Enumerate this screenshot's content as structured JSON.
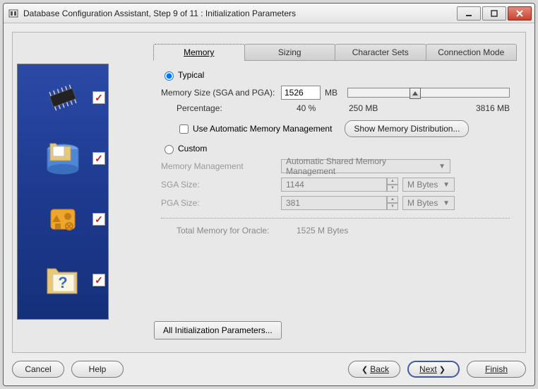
{
  "window": {
    "title": "Database Configuration Assistant, Step 9 of 11 : Initialization Parameters"
  },
  "tabs": {
    "memory": "Memory",
    "sizing": "Sizing",
    "charsets": "Character Sets",
    "connmode": "Connection Mode"
  },
  "typical": {
    "radio_label": "Typical",
    "mem_size_label": "Memory Size (SGA and PGA):",
    "mem_size_value": "1526",
    "mem_size_unit": "MB",
    "percentage_label": "Percentage:",
    "percentage_value": "40 %",
    "slider_min": "250 MB",
    "slider_max": "3816 MB",
    "auto_mem_label": "Use Automatic Memory Management",
    "show_btn": "Show Memory Distribution..."
  },
  "custom": {
    "radio_label": "Custom",
    "mem_mgmt_label": "Memory Management",
    "mem_mgmt_value": "Automatic Shared Memory Management",
    "sga_label": "SGA Size:",
    "sga_value": "1144",
    "sga_unit": "M Bytes",
    "pga_label": "PGA Size:",
    "pga_value": "381",
    "pga_unit": "M Bytes",
    "total_label": "Total Memory for Oracle:",
    "total_value": "1525 M Bytes"
  },
  "buttons": {
    "all_params": "All Initialization Parameters...",
    "cancel": "Cancel",
    "help": "Help",
    "back": "Back",
    "next": "Next",
    "finish": "Finish"
  }
}
